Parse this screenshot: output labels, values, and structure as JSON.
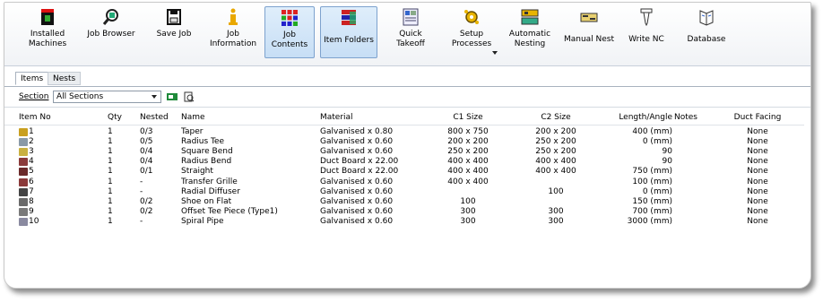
{
  "ribbon": {
    "buttons": [
      {
        "label": "Installed\nMachines",
        "icon": "machine-icon"
      },
      {
        "label": "Job Browser",
        "icon": "magnifier-icon"
      },
      {
        "label": "Save Job",
        "icon": "floppy-disk-icon"
      },
      {
        "label": "Job\nInformation",
        "icon": "info-icon"
      },
      {
        "label": "Job\nContents",
        "icon": "grid-icon"
      },
      {
        "label": "Item Folders",
        "icon": "folders-icon"
      },
      {
        "label": "Quick\nTakeoff",
        "icon": "takeoff-icon"
      },
      {
        "label": "Setup\nProcesses",
        "icon": "gears-icon"
      },
      {
        "label": "Automatic\nNesting",
        "icon": "nesting-icon"
      },
      {
        "label": "Manual Nest",
        "icon": "manual-nest-icon"
      },
      {
        "label": "Write NC",
        "icon": "tool-icon"
      },
      {
        "label": "Database",
        "icon": "database-icon"
      }
    ]
  },
  "tabs": [
    "Items",
    "Nests"
  ],
  "toolbar": {
    "section_label": "Section",
    "section_value": "All Sections"
  },
  "table": {
    "headers": [
      "Item No",
      "Qty",
      "Nested",
      "Name",
      "Material",
      "C1 Size",
      "C2 Size",
      "Length/Angle",
      "Notes",
      "Duct Facing"
    ],
    "rows": [
      {
        "item": "1",
        "qty": "1",
        "nested": "0/3",
        "name": "Taper",
        "material": "Galvanised x 0.80",
        "c1": "800 x 750",
        "c2": "200 x 200",
        "length": "400 (mm)",
        "notes": "",
        "duct": "None"
      },
      {
        "item": "2",
        "qty": "1",
        "nested": "0/5",
        "name": "Radius Tee",
        "material": "Galvanised x 0.60",
        "c1": "200 x 200",
        "c2": "250 x 200",
        "length": "0 (mm)",
        "notes": "",
        "duct": "None"
      },
      {
        "item": "3",
        "qty": "1",
        "nested": "0/4",
        "name": "Square Bend",
        "material": "Galvanised x 0.60",
        "c1": "250 x 200",
        "c2": "250 x 200",
        "length": "90",
        "notes": "",
        "duct": "None"
      },
      {
        "item": "4",
        "qty": "1",
        "nested": "0/4",
        "name": "Radius Bend",
        "material": "Duct Board x 22.00",
        "c1": "400 x 400",
        "c2": "400 x 400",
        "length": "90",
        "notes": "",
        "duct": "None"
      },
      {
        "item": "5",
        "qty": "1",
        "nested": "0/1",
        "name": "Straight",
        "material": "Duct Board x 22.00",
        "c1": "400 x 400",
        "c2": "400 x 400",
        "length": "750 (mm)",
        "notes": "",
        "duct": "None"
      },
      {
        "item": "6",
        "qty": "1",
        "nested": "-",
        "name": "Transfer Grille",
        "material": "Galvanised x 0.60",
        "c1": "400 x 400",
        "c2": "",
        "length": "100 (mm)",
        "notes": "",
        "duct": "None"
      },
      {
        "item": "7",
        "qty": "1",
        "nested": "-",
        "name": "Radial Diffuser",
        "material": "Galvanised x 0.60",
        "c1": "",
        "c2": "100",
        "length": "0 (mm)",
        "notes": "",
        "duct": "None"
      },
      {
        "item": "8",
        "qty": "1",
        "nested": "0/2",
        "name": "Shoe on Flat",
        "material": "Galvanised x 0.60",
        "c1": "100",
        "c2": "",
        "length": "150 (mm)",
        "notes": "",
        "duct": "None"
      },
      {
        "item": "9",
        "qty": "1",
        "nested": "0/2",
        "name": "Offset Tee Piece (Type1)",
        "material": "Galvanised x 0.60",
        "c1": "300",
        "c2": "300",
        "length": "700 (mm)",
        "notes": "",
        "duct": "None"
      },
      {
        "item": "10",
        "qty": "1",
        "nested": "-",
        "name": "Spiral Pipe",
        "material": "Galvanised x 0.60",
        "c1": "300",
        "c2": "300",
        "length": "3000 (mm)",
        "notes": "",
        "duct": "None"
      }
    ]
  }
}
